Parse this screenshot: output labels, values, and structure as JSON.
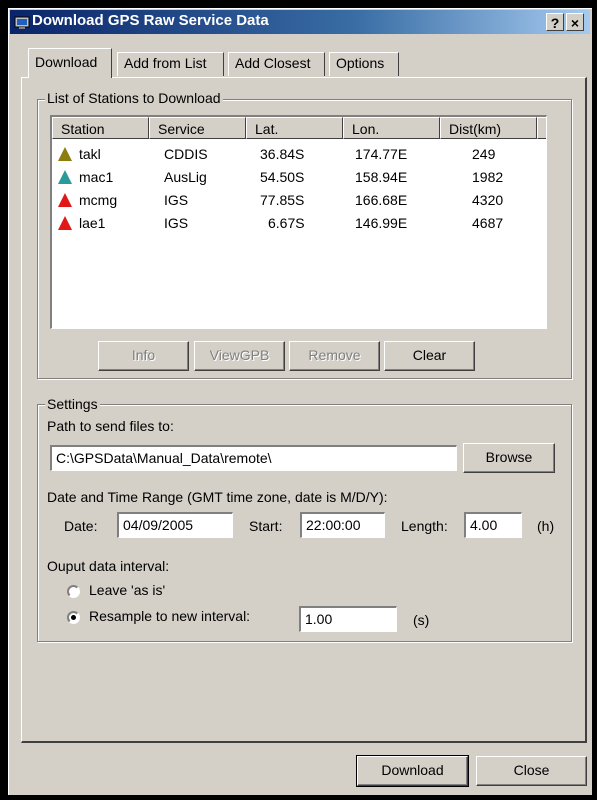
{
  "window": {
    "title": "Download GPS Raw Service Data",
    "help_btn": "?",
    "close_btn": "×"
  },
  "tabs": [
    {
      "label": "Download"
    },
    {
      "label": "Add from List"
    },
    {
      "label": "Add Closest"
    },
    {
      "label": "Options"
    }
  ],
  "stations_group": {
    "legend": "List of Stations to Download",
    "columns": [
      "Station",
      "Service",
      "Lat.",
      "Lon.",
      "Dist(km)"
    ],
    "rows": [
      {
        "station": "takl",
        "service": "CDDIS",
        "lat": "36.84S",
        "lon": "174.77E",
        "dist": "249",
        "marker_color": "#8b7d10"
      },
      {
        "station": "mac1",
        "service": "AusLig",
        "lat": "54.50S",
        "lon": "158.94E",
        "dist": "1982",
        "marker_color": "#2a9a9a"
      },
      {
        "station": "mcmg",
        "service": "IGS",
        "lat": "77.85S",
        "lon": "166.68E",
        "dist": "4320",
        "marker_color": "#e01818"
      },
      {
        "station": "lae1",
        "service": "IGS",
        "lat": "6.67S",
        "lon": "146.99E",
        "dist": "4687",
        "marker_color": "#e01818"
      }
    ],
    "buttons": {
      "info": "Info",
      "viewgpb": "ViewGPB",
      "remove": "Remove",
      "clear": "Clear"
    }
  },
  "settings": {
    "legend": "Settings",
    "path_label": "Path to send files to:",
    "path_value": "C:\\GPSData\\Manual_Data\\remote\\",
    "browse": "Browse",
    "range_label": "Date and Time Range (GMT time zone, date is M/D/Y):",
    "date_label": "Date:",
    "date_value": "04/09/2005",
    "start_label": "Start:",
    "start_value": "22:00:00",
    "length_label": "Length:",
    "length_value": "4.00",
    "length_unit": "(h)",
    "interval_label": "Ouput data interval:",
    "radio_leave": "Leave 'as is'",
    "radio_resample": "Resample to new interval:",
    "resample_value": "1.00",
    "resample_unit": "(s)",
    "selected_option": "resample"
  },
  "footer": {
    "download": "Download",
    "close": "Close"
  }
}
